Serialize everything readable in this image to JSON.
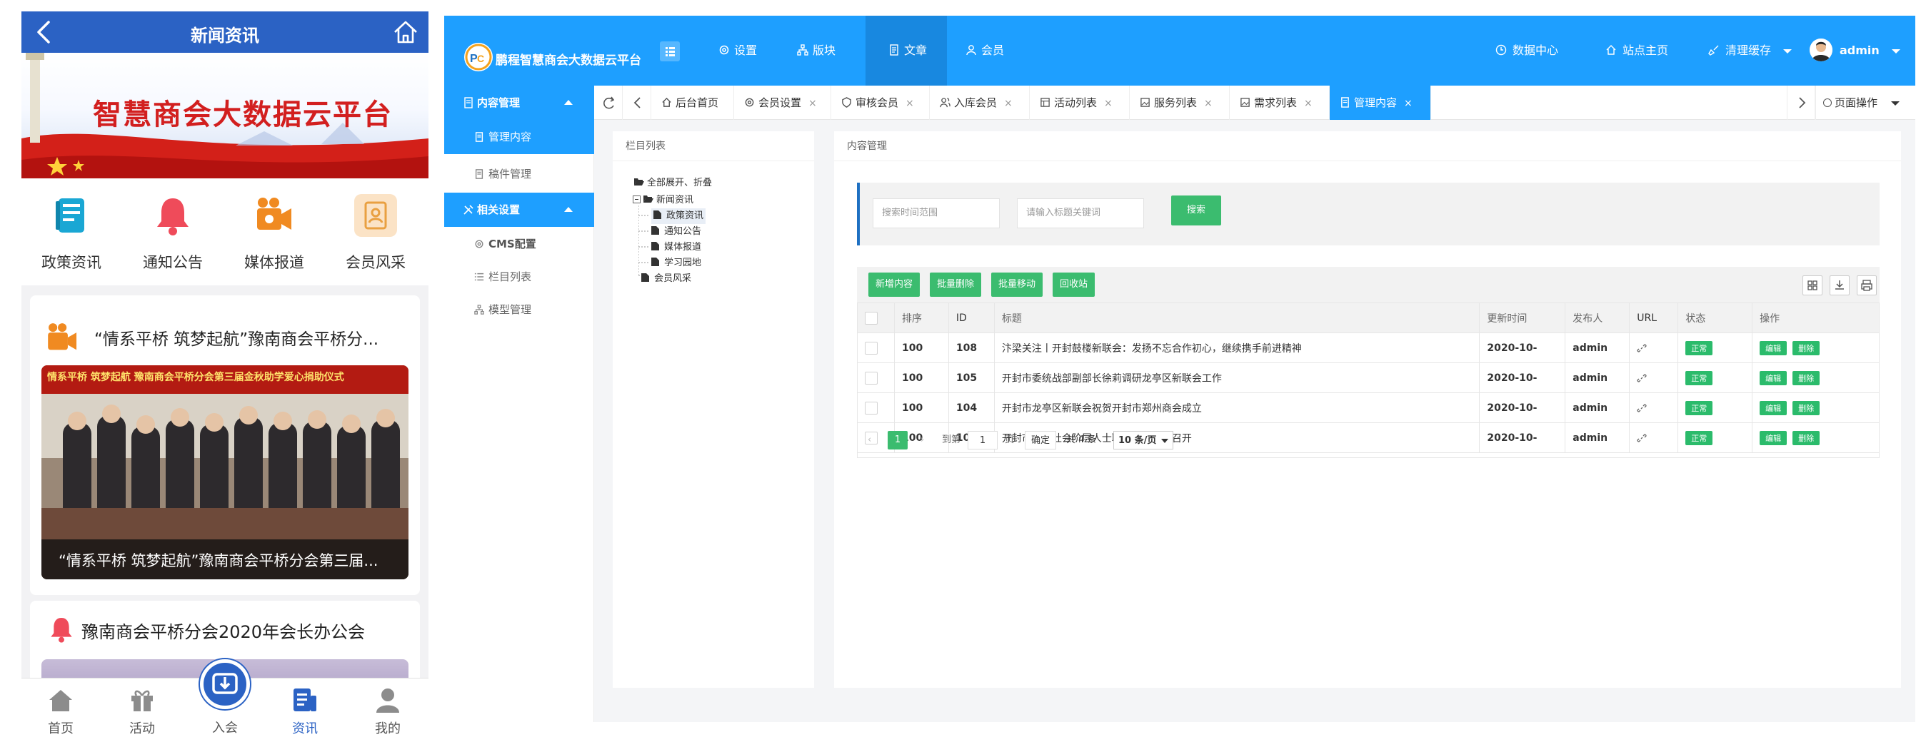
{
  "mobile": {
    "header_title": "新闻资讯",
    "banner_text": "智慧商会大数据云平台",
    "icons": [
      {
        "label": "政策资讯",
        "color": "#1aa7d4"
      },
      {
        "label": "通知公告",
        "color": "#ef4b5a"
      },
      {
        "label": "媒体报道",
        "color": "#f08a21"
      },
      {
        "label": "会员风采",
        "color": "#e9a041"
      }
    ],
    "news1_title": "“情系平桥 筑梦起航”豫南商会平桥分...",
    "news1_photo_banner": "情系平桥 筑梦起航 豫南商会平桥分会第三届金秋助学爱心捐助仪式",
    "news1_caption": "“情系平桥 筑梦起航”豫南商会平桥分会第三届...",
    "news2_title": "豫南商会平桥分会2020年会长办公会",
    "tabs": [
      {
        "label": "首页"
      },
      {
        "label": "活动"
      },
      {
        "label": "入会"
      },
      {
        "label": "资讯"
      },
      {
        "label": "我的"
      }
    ],
    "accent": "#2b62c4"
  },
  "admin": {
    "brand": "鹏程智慧商会大数据云平台",
    "nav": [
      {
        "label": "设置",
        "icon": "gear-icon"
      },
      {
        "label": "版块",
        "icon": "sitemap-icon"
      },
      {
        "label": "文章",
        "icon": "document-icon"
      },
      {
        "label": "会员",
        "icon": "user-icon"
      }
    ],
    "right": {
      "data_center": "数据中心",
      "site_home": "站点主页",
      "clear_cache": "清理缓存",
      "user": "admin"
    },
    "sidebar": {
      "group1": "内容管理",
      "g1_items": [
        "管理内容",
        "稿件管理"
      ],
      "group2": "相关设置",
      "g2_items": [
        "CMS配置",
        "栏目列表",
        "模型管理"
      ]
    },
    "tabs": [
      {
        "label": "后台首页",
        "closable": false
      },
      {
        "label": "会员设置",
        "closable": true
      },
      {
        "label": "审核会员",
        "closable": true
      },
      {
        "label": "入库会员",
        "closable": true
      },
      {
        "label": "活动列表",
        "closable": true
      },
      {
        "label": "服务列表",
        "closable": true
      },
      {
        "label": "需求列表",
        "closable": true
      },
      {
        "label": "管理内容",
        "closable": true
      }
    ],
    "tab_close": "×",
    "page_ops": "页面操作",
    "tree": {
      "title": "栏目列表",
      "toggle": "全部展开、折叠",
      "root": "新闻资讯",
      "children": [
        "政策资讯",
        "通知公告",
        "媒体报道",
        "学习园地"
      ],
      "other": "会员风采"
    },
    "content": {
      "title": "内容管理",
      "time_placeholder": "搜索时间范围",
      "keyword_placeholder": "请输入标题关键词",
      "search_btn": "搜索",
      "actions": [
        "新增内容",
        "批量删除",
        "批量移动",
        "回收站"
      ],
      "columns": [
        "排序",
        "ID",
        "标题",
        "更新时间",
        "发布人",
        "URL",
        "状态",
        "操作"
      ],
      "rows": [
        {
          "sort": "100",
          "id": "108",
          "title": "汴梁关注丨开封鼓楼新联会：发扬不忘合作初心，继续携手前进精神",
          "time": "2020-10-",
          "author": "admin",
          "status": "正常"
        },
        {
          "sort": "100",
          "id": "105",
          "title": "开封市委统战部副部长徐莉调研龙亭区新联会工作",
          "time": "2020-10-",
          "author": "admin",
          "status": "正常"
        },
        {
          "sort": "100",
          "id": "104",
          "title": "开封市龙亭区新联会祝贺开封市郑州商会成立",
          "time": "2020-10-",
          "author": "admin",
          "status": "正常"
        },
        {
          "sort": "100",
          "id": "101",
          "title": "开封市新的社会阶层人士联谊会会长会召开",
          "time": "2020-10-",
          "author": "admin",
          "status": "正常"
        }
      ],
      "edit_label": "编辑",
      "delete_label": "删除",
      "pager": {
        "current": "1",
        "goto_label": "到第",
        "page_input": "1",
        "page_unit": "页",
        "confirm": "确定",
        "total": "共 4 条",
        "per_page": "10 条/页"
      }
    },
    "accent": "#1e9fff",
    "green": "#3bbc6f"
  }
}
